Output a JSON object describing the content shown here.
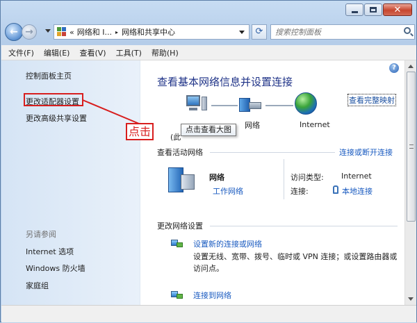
{
  "window": {
    "minimize_label": "minimize",
    "maximize_label": "maximize",
    "close_glyph": "✕"
  },
  "nav": {
    "back_glyph": "←",
    "forward_glyph": "→",
    "breadcrumb": [
      "«",
      "网络和 I...",
      "▸",
      "网络和共享中心"
    ],
    "refresh_glyph": "⟳",
    "search_placeholder": "搜索控制面板"
  },
  "menu": [
    "文件(F)",
    "编辑(E)",
    "查看(V)",
    "工具(T)",
    "帮助(H)"
  ],
  "sidebar": {
    "items": [
      "控制面板主页",
      "更改适配器设置",
      "更改高级共享设置"
    ],
    "see_also_title": "另请参阅",
    "see_also": [
      "Internet 选项",
      "Windows 防火墙",
      "家庭组"
    ]
  },
  "main": {
    "help_glyph": "?",
    "title": "查看基本网络信息并设置连接",
    "view_full_map": "查看完整映射",
    "map_labels": {
      "computer": "(此",
      "network": "网络",
      "internet": "Internet"
    },
    "tooltip": "点击查看大图",
    "active_networks_title": "查看活动网络",
    "connect_disconnect": "连接或断开连接",
    "network_name": "网络",
    "network_type": "工作网络",
    "access_type_label": "访问类型:",
    "access_type_value": "Internet",
    "connections_label": "连接:",
    "connections_value": "本地连接",
    "change_settings_title": "更改网络设置",
    "setup_new": "设置新的连接或网络",
    "setup_new_desc": "设置无线、宽带、拨号、临时或 VPN 连接；或设置路由器或访问点。",
    "connect_to": "连接到网络"
  },
  "annotation": {
    "label": "点击",
    "color": "#d81e1e"
  }
}
